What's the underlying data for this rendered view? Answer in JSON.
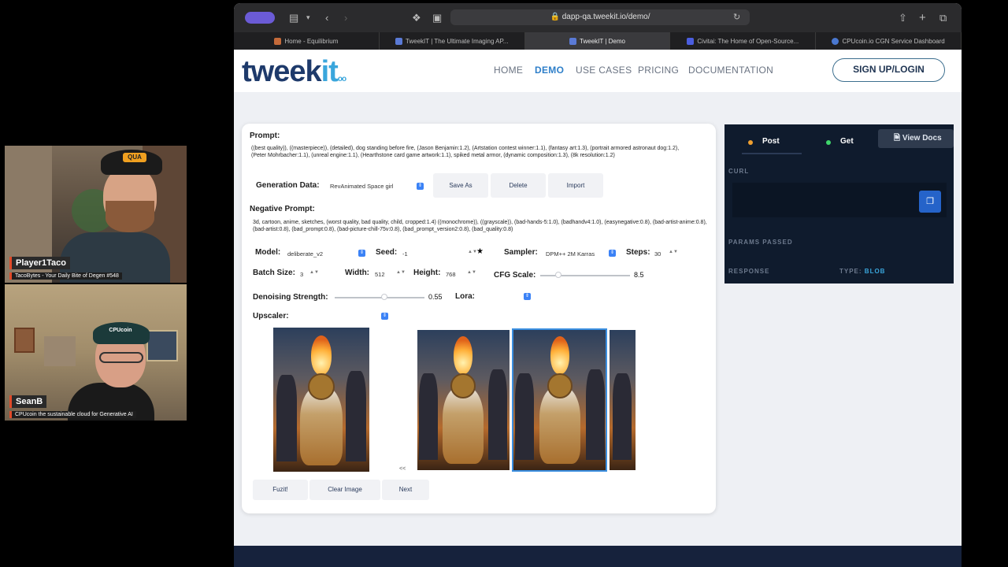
{
  "participants": [
    {
      "name": "Player1Taco",
      "tagline": "TacoBytes - Your Daily Bite of Degen #548",
      "cap_text": "QUA"
    },
    {
      "name": "SeanB",
      "tagline": "CPUcoin the sustainable cloud for Generative AI",
      "cap_text": "CPUcoin"
    }
  ],
  "browser": {
    "url": "dapp-qa.tweekit.io/demo/",
    "tabs": [
      {
        "label": "Home - Equilibrium",
        "active": false
      },
      {
        "label": "TweekIT | The Ultimate Imaging AP...",
        "active": false
      },
      {
        "label": "TweekIT | Demo",
        "active": true
      },
      {
        "label": "Civitai: The Home of Open-Source...",
        "active": false
      },
      {
        "label": "CPUcoin.io CGN Service Dashboard",
        "active": false
      }
    ]
  },
  "site": {
    "logo_main": "tweek",
    "logo_accent": "it",
    "logo_sub": "oo",
    "nav": [
      {
        "label": "HOME",
        "active": false
      },
      {
        "label": "DEMO",
        "active": true
      },
      {
        "label": "USE CASES",
        "active": false
      },
      {
        "label": "PRICING",
        "active": false
      },
      {
        "label": "DOCUMENTATION",
        "active": false
      }
    ],
    "signup_label": "SIGN UP/LOGIN"
  },
  "form": {
    "prompt_label": "Prompt:",
    "prompt_text": "((best quality)), ((masterpiece)), (detailed), dog standing before fire, (Jason Benjamin:1.2), (Artstation contest winner:1.1), (fantasy art:1.3), (portrait armored astronaut dog:1.2), (Peter Mohrbacher:1.1), (unreal engine:1.1), (Hearthstone card game artwork:1.1), spiked metal armor, (dynamic composition:1.3), (8k resolution:1.2)",
    "generation_label": "Generation Data:",
    "generation_value": "RevAnimated Space girl",
    "save_as": "Save As",
    "delete": "Delete",
    "import": "Import",
    "negative_label": "Negative Prompt:",
    "negative_text": "3d, cartoon, anime, sketches, (worst quality, bad quality, child, cropped:1.4) ((monochrome)), ((grayscale)), (bad-hands-5:1.0), (badhandv4:1.0), (easynegative:0.8), (bad-artist-anime:0.8), (bad-artist:0.8), (bad_prompt:0.8), (bad-picture-chill-75v:0.8), (bad_prompt_version2:0.8), (bad_quality:0.8)",
    "model_label": "Model:",
    "model_value": "deliberate_v2",
    "seed_label": "Seed:",
    "seed_value": "-1",
    "sampler_label": "Sampler:",
    "sampler_value": "DPM++ 2M Karras",
    "steps_label": "Steps:",
    "steps_value": "30",
    "batch_label": "Batch Size:",
    "batch_value": "3",
    "width_label": "Width:",
    "width_value": "512",
    "height_label": "Height:",
    "height_value": "768",
    "cfg_label": "CFG Scale:",
    "cfg_value": "8.5",
    "cfg_level": 0.2,
    "denoise_label": "Denoising Strength:",
    "denoise_value": "0.55",
    "denoise_level": 0.55,
    "lora_label": "Lora:",
    "upscaler_label": "Upscaler:",
    "prev_label": "<<",
    "fuzit": "Fuzit!",
    "clear_image": "Clear Image",
    "next": "Next"
  },
  "api": {
    "post": "Post",
    "get": "Get",
    "view_docs": "View Docs",
    "curl": "CURL",
    "params": "PARAMS PASSED",
    "response": "RESPONSE",
    "type_label": "TYPE:",
    "type_value": "BLOB",
    "colors": {
      "post_dot": "#f0a030",
      "get_dot": "#3fd66b"
    }
  }
}
